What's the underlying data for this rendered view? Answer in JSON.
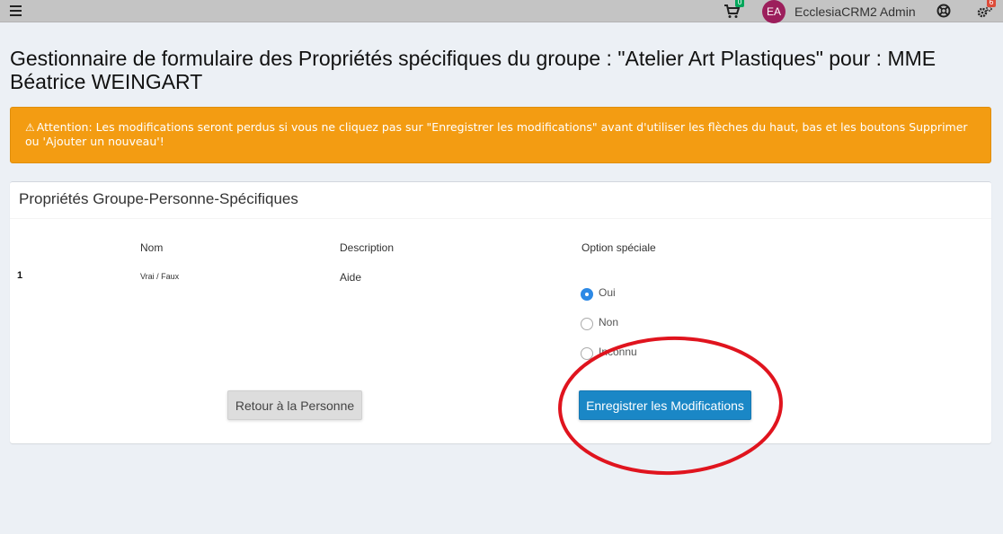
{
  "navbar": {
    "cart_count": "0",
    "avatar_initials": "EA",
    "user_name": "EcclesiaCRM2 Admin",
    "settings_count": "6"
  },
  "page": {
    "title": "Gestionnaire de formulaire des Propriétés spécifiques du groupe : \"Atelier Art Plastiques\" pour : MME Béatrice WEINGART"
  },
  "alert": {
    "icon": "warning-icon",
    "text": "Attention: Les modifications seront perdus si vous ne cliquez pas sur \"Enregistrer les modifications\" avant d'utiliser les flèches du haut, bas et les boutons Supprimer ou 'Ajouter un nouveau'!",
    "color": "#f39c12"
  },
  "box": {
    "title": "Propriétés Groupe-Personne-Spécifiques",
    "headers": {
      "name": "Nom",
      "description": "Description",
      "option": "Option spéciale"
    },
    "rows": [
      {
        "number": "1",
        "type": "Vrai / Faux",
        "description": "Aide",
        "options": [
          {
            "label": "Oui",
            "checked": true
          },
          {
            "label": "Non",
            "checked": false
          },
          {
            "label": "Inconnu",
            "checked": false
          }
        ]
      }
    ],
    "back_button": "Retour à la Personne",
    "save_button": "Enregistrer les Modifications"
  },
  "colors": {
    "primary": "#1a87c6",
    "warning": "#f39c12",
    "annotation": "#e0141e"
  }
}
